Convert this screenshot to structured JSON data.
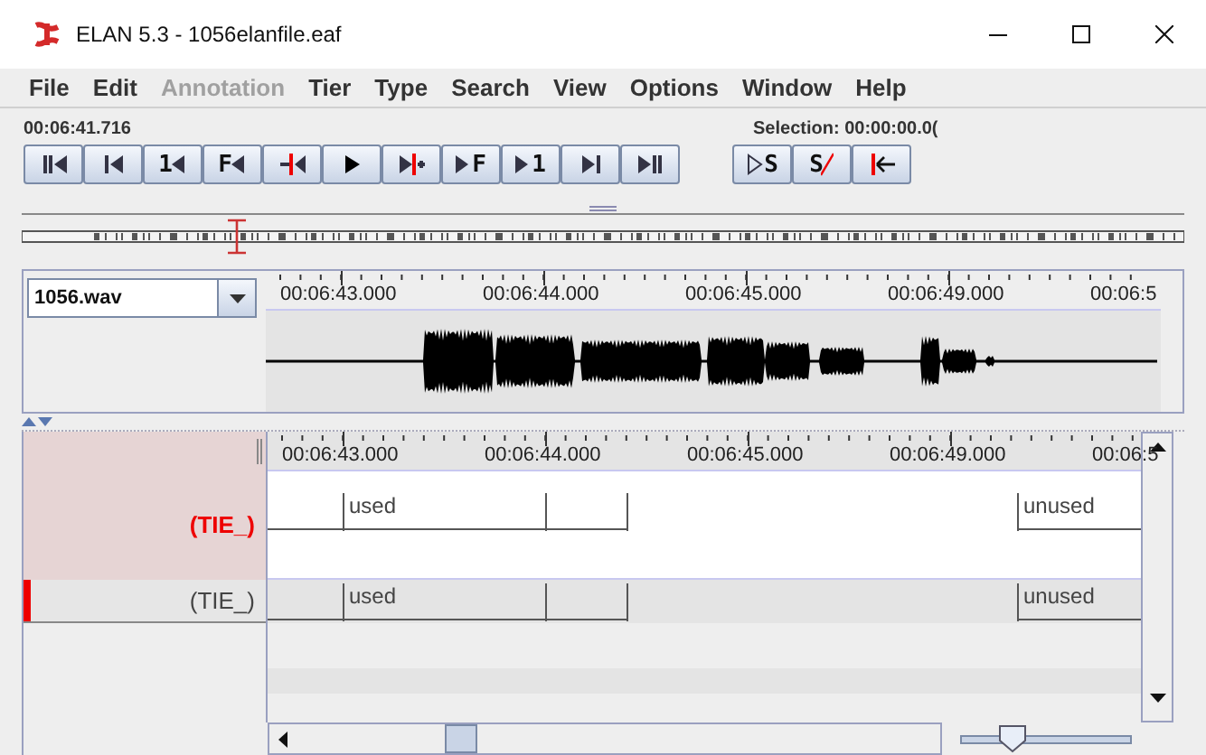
{
  "window": {
    "title": "ELAN 5.3 - 1056elanfile.eaf"
  },
  "menu": [
    {
      "label": "File",
      "disabled": false
    },
    {
      "label": "Edit",
      "disabled": false
    },
    {
      "label": "Annotation",
      "disabled": true
    },
    {
      "label": "Tier",
      "disabled": false
    },
    {
      "label": "Type",
      "disabled": false
    },
    {
      "label": "Search",
      "disabled": false
    },
    {
      "label": "View",
      "disabled": false
    },
    {
      "label": "Options",
      "disabled": false
    },
    {
      "label": "Window",
      "disabled": false
    },
    {
      "label": "Help",
      "disabled": false
    }
  ],
  "time": "00:06:41.716",
  "selection": "Selection: 00:00:00.0(",
  "player_buttons": [
    {
      "kind": "begin"
    },
    {
      "kind": "prev-frame"
    },
    {
      "kind": "back",
      "label": "1"
    },
    {
      "kind": "back",
      "label": "F"
    },
    {
      "kind": "to-selection-begin"
    },
    {
      "kind": "play"
    },
    {
      "kind": "play-around"
    },
    {
      "kind": "forward",
      "label": "F"
    },
    {
      "kind": "forward",
      "label": "1"
    },
    {
      "kind": "next-frame"
    },
    {
      "kind": "end"
    }
  ],
  "selection_buttons": [
    {
      "kind": "play-selection",
      "label": "S"
    },
    {
      "kind": "clear-selection",
      "label": "S"
    },
    {
      "kind": "to-begin"
    }
  ],
  "media": {
    "file": "1056.wav"
  },
  "ruler": [
    "00:06:43.000",
    "00:06:44.000",
    "00:06:45.000",
    "00:06:49.000",
    "00:06:5"
  ],
  "tier_ruler": [
    "00:06:43.000",
    "00:06:44.000",
    "00:06:45.000",
    "00:06:49.000",
    "00:06:5"
  ],
  "tiers": [
    {
      "name": "(TIE_)",
      "selected": true,
      "marker": false,
      "annotations": [
        "used",
        "unused"
      ]
    },
    {
      "name": "(TIE_)",
      "selected": false,
      "marker": true,
      "annotations": [
        "used",
        "unused"
      ]
    }
  ],
  "zoom_slider": {
    "level": 0.3
  }
}
